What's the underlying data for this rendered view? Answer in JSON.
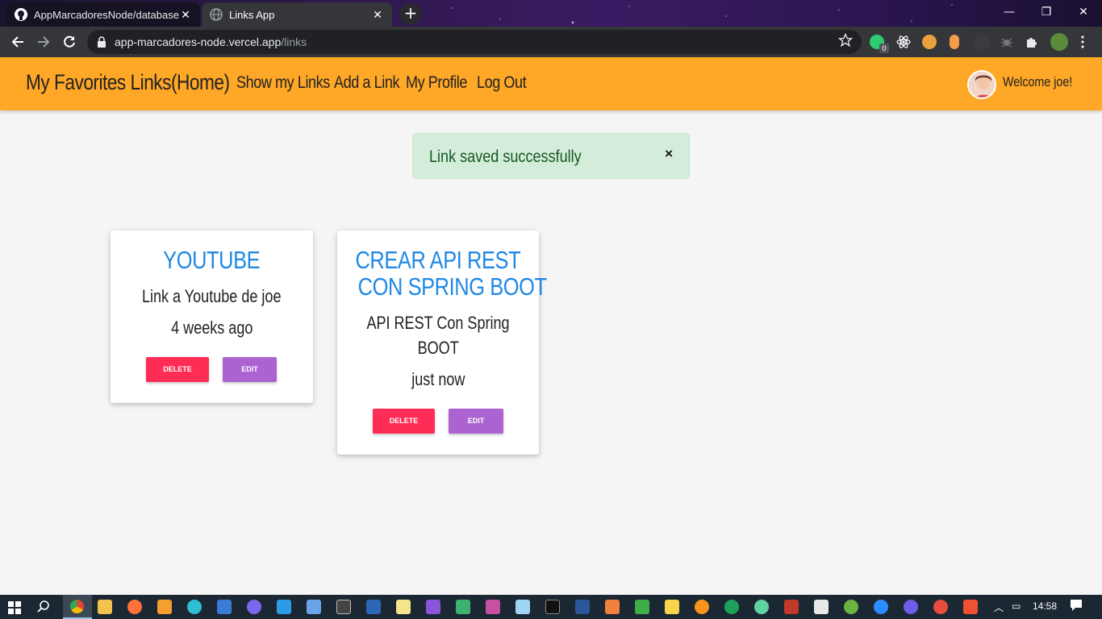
{
  "browser": {
    "tabs": [
      {
        "title": "AppMarcadoresNode/database.js",
        "icon": "github-icon"
      },
      {
        "title": "Links App",
        "icon": "globe-icon"
      }
    ],
    "url_host": "app-marcadores-node.vercel.app",
    "url_path": "/links",
    "extension_badge": "0"
  },
  "navbar": {
    "brand": "My Favorites Links(Home)",
    "links": [
      "Show my Links",
      "Add a Link",
      "My Profile",
      "Log Out"
    ],
    "welcome": "Welcome joe!"
  },
  "alert": {
    "message": "Link saved successfully",
    "close_symbol": "×"
  },
  "cards": [
    {
      "title": "Youtube",
      "description": "Link a Youtube de joe",
      "date": "4 weeks ago",
      "delete_label": "Delete",
      "edit_label": "Edit"
    },
    {
      "title_lines": [
        "Crear API REST",
        "con Spring Boot"
      ],
      "description_lines": [
        "API REST Con Spring",
        "BOOT"
      ],
      "date": "just now",
      "delete_label": "Delete",
      "edit_label": "Edit"
    }
  ],
  "taskbar": {
    "time": "14:58"
  },
  "colors": {
    "navbar": "#ffa726",
    "card_title": "#1e88e5",
    "delete_button": "#ff2d55",
    "edit_button": "#ab63d1",
    "alert_bg": "#d4edda",
    "alert_text": "#155724"
  }
}
